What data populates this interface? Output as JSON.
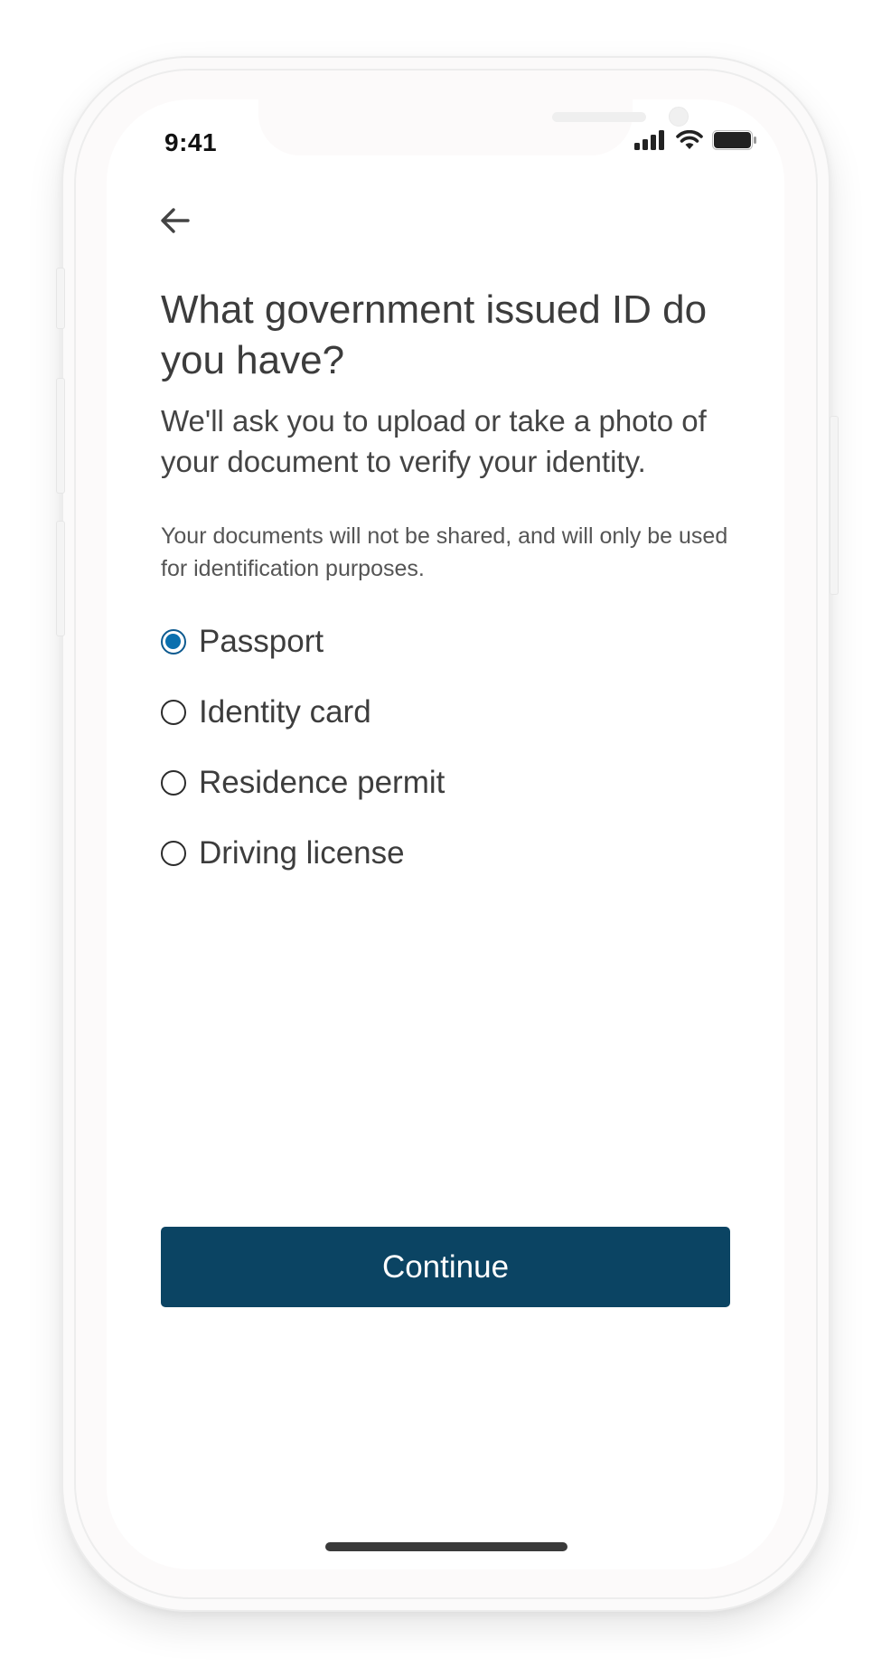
{
  "status_bar": {
    "time": "9:41",
    "icons": [
      "cellular-signal-icon",
      "wifi-icon",
      "battery-icon"
    ]
  },
  "nav": {
    "back_icon": "arrow-left-icon"
  },
  "header": {
    "title": "What government issued ID do you have?",
    "subtitle": "We'll ask you to upload or take a photo of your document to verify your identity."
  },
  "note": "Your documents will not be shared, and will only be used for identification purposes.",
  "options": [
    {
      "label": "Passport",
      "selected": true
    },
    {
      "label": "Identity card",
      "selected": false
    },
    {
      "label": "Residence permit",
      "selected": false
    },
    {
      "label": "Driving license",
      "selected": false
    }
  ],
  "primary_button": {
    "label": "Continue"
  },
  "colors": {
    "button_background": "#0b4463",
    "radio_selected": "#0a6fae",
    "text_primary": "#3c3c3c"
  }
}
